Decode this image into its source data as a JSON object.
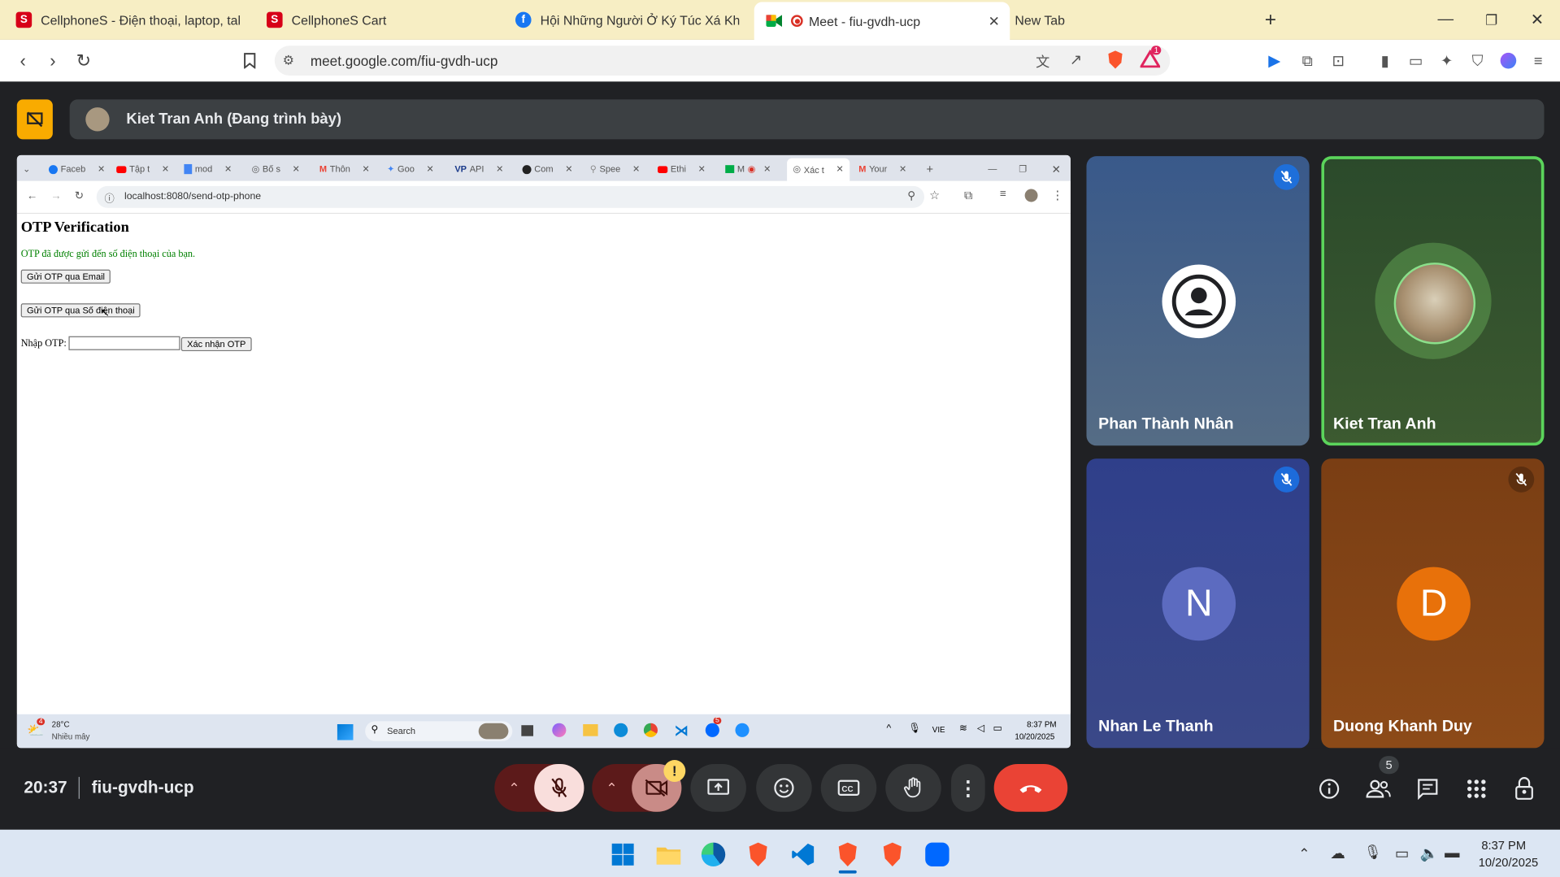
{
  "browser": {
    "tabs": [
      {
        "title": "CellphoneS - Điện thoại, laptop, table",
        "icon": "cellphones-s-icon"
      },
      {
        "title": "CellphoneS Cart",
        "icon": "cellphones-s-icon"
      },
      {
        "title": "Hội Những Người Ở Ký Túc Xá Khu B",
        "icon": "facebook-icon"
      },
      {
        "title": "Meet - fiu-gvdh-ucp",
        "icon": "google-meet-icon"
      },
      {
        "title": "New Tab",
        "icon": ""
      }
    ],
    "url": "meet.google.com/fiu-gvdh-ucp",
    "notif_count": "1"
  },
  "meet": {
    "presenter_label": "Kiet Tran Anh (Đang trình bày)",
    "time": "20:37",
    "meeting_code": "fiu-gvdh-ucp",
    "participants_count": "5",
    "participants": [
      {
        "name": "Phan Thành Nhân",
        "initial": "",
        "color": "#4a6b8f"
      },
      {
        "name": "Kiet Tran Anh",
        "initial": "",
        "color": "#2e5a2e"
      },
      {
        "name": "Nhan Le Thanh",
        "initial": "N",
        "color": "#3a4a90"
      },
      {
        "name": "Duong Khanh Duy",
        "initial": "D",
        "color": "#8a4a15"
      }
    ],
    "warning_badge": "!"
  },
  "shared_screen": {
    "tabs": [
      "Faceb",
      "Tập t",
      "mod",
      "Bố s",
      "Thôn",
      "Goo",
      "API",
      "Com",
      "Spee",
      "Ethi",
      "M",
      "Xác t",
      "Your"
    ],
    "url": "localhost:8080/send-otp-phone",
    "page": {
      "heading": "OTP Verification",
      "success_msg": "OTP đã được gửi đến số điện thoại của bạn.",
      "email_btn": "Gửi OTP qua Email",
      "phone_btn": "Gửi OTP qua Số điện thoại",
      "otp_label": "Nhập OTP:",
      "otp_value": "",
      "confirm_btn": "Xác nhận OTP"
    },
    "taskbar": {
      "weather_temp": "28°C",
      "weather_desc": "Nhiều mây",
      "weather_badge": "4",
      "search_label": "Search",
      "lang": "VIE",
      "time": "8:37 PM",
      "date": "10/20/2025",
      "app_badge": "5"
    }
  },
  "windows_taskbar": {
    "time": "8:37 PM",
    "date": "10/20/2025"
  }
}
